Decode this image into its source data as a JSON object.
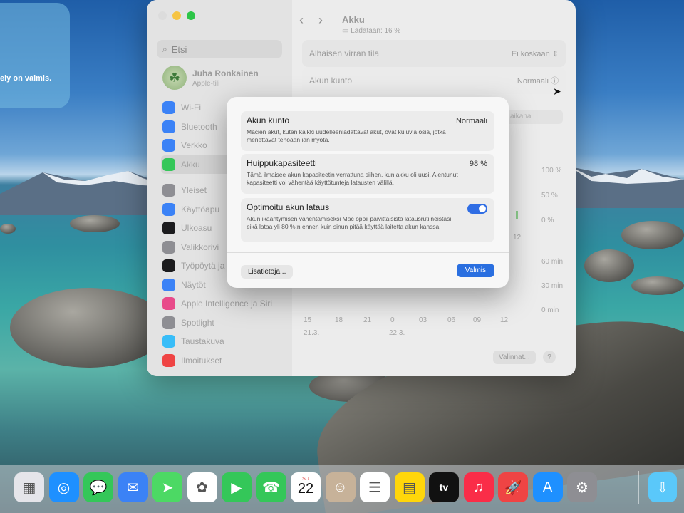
{
  "desktop": {
    "notification_text": "ely on valmis."
  },
  "window": {
    "header": {
      "title": "Akku",
      "subtitle": "Ladataan: 16 %",
      "back": "‹",
      "forward": "›"
    },
    "sidebar": {
      "search_placeholder": "Etsi",
      "user": {
        "name": "Juha Ronkainen",
        "subtitle": "Apple-tili"
      },
      "items": [
        {
          "label": "Wi-Fi",
          "icon": "wifi-icon",
          "color": "#3b82f6"
        },
        {
          "label": "Bluetooth",
          "icon": "bluetooth-icon",
          "color": "#3b82f6"
        },
        {
          "label": "Verkko",
          "icon": "globe-icon",
          "color": "#3b82f6"
        },
        {
          "label": "Akku",
          "icon": "battery-icon",
          "color": "#34c759",
          "active": true
        },
        {
          "label": "Yleiset",
          "icon": "gear-icon",
          "color": "#8e8e93",
          "gap": true
        },
        {
          "label": "Käyttöapu",
          "icon": "accessibility-icon",
          "color": "#3b82f6"
        },
        {
          "label": "Ulkoasu",
          "icon": "appearance-icon",
          "color": "#1c1c1e"
        },
        {
          "label": "Valikkorivi",
          "icon": "menubar-icon",
          "color": "#8e8e93"
        },
        {
          "label": "Työpöytä ja",
          "icon": "dock-icon",
          "color": "#1c1c1e"
        },
        {
          "label": "Näytöt",
          "icon": "display-icon",
          "color": "#3b82f6"
        },
        {
          "label": "Apple Intelligence ja Siri",
          "icon": "siri-icon",
          "color": "#e84b8a"
        },
        {
          "label": "Spotlight",
          "icon": "spotlight-icon",
          "color": "#8e8e93"
        },
        {
          "label": "Taustakuva",
          "icon": "wallpaper-icon",
          "color": "#38bdf8"
        },
        {
          "label": "Ilmoitukset",
          "icon": "notifications-icon",
          "color": "#ef4444"
        }
      ]
    },
    "rows": [
      {
        "label": "Alhaisen virran tila",
        "value": "Ei koskaan"
      },
      {
        "label": "Akun kunto",
        "value": "Normaali"
      }
    ],
    "hint_text": "aikana",
    "chart": {
      "y_top": [
        "100 %",
        "50 %",
        "0 %"
      ],
      "x_top_partial": "12",
      "y_bottom": [
        "60 min",
        "30 min",
        "0 min"
      ],
      "x_bottom": [
        "15",
        "18",
        "21",
        "0",
        "03",
        "06",
        "09",
        "12"
      ],
      "dates": [
        "21.3.",
        "22.3."
      ]
    },
    "footer": {
      "options_label": "Valinnat...",
      "help_label": "?"
    }
  },
  "dialog": {
    "sections": [
      {
        "title": "Akun kunto",
        "value": "Normaali",
        "description": "Macien akut, kuten kaikki uudelleenladattavat akut, ovat kuluvia osia, jotka menettävät tehoaan iän myötä."
      },
      {
        "title": "Huippukapasiteetti",
        "value": "98 %",
        "description": "Tämä ilmaisee akun kapasiteetin verrattuna siihen, kun akku oli uusi. Alentunut kapasiteetti voi vähentää käyttötunteja latausten välillä."
      },
      {
        "title": "Optimoitu akun lataus",
        "toggle_on": true,
        "description": "Akun ikääntymisen vähentämiseksi Mac oppii päivittäisistä latausrutiineistasi eikä lataa yli 80 %:n ennen kuin sinun pitää käyttää laitetta akun kanssa."
      }
    ],
    "buttons": {
      "more_info": "Lisätietoja...",
      "done": "Valmis"
    }
  },
  "dock": {
    "calendar": {
      "month": "SU",
      "day": "22"
    },
    "apple_tv_label": "tv",
    "apps": [
      {
        "name": "launchpad-icon",
        "color": "#e5e5ea"
      },
      {
        "name": "safari-icon",
        "color": "#1e90ff"
      },
      {
        "name": "messages-icon",
        "color": "#34c759"
      },
      {
        "name": "mail-icon",
        "color": "#3b82f6"
      },
      {
        "name": "maps-icon",
        "color": "#4cd964"
      },
      {
        "name": "photos-icon",
        "color": "#ffffff"
      },
      {
        "name": "facetime-icon",
        "color": "#34c759"
      },
      {
        "name": "phone-icon",
        "color": "#34c759"
      },
      {
        "name": "calendar-icon",
        "color": "#ffffff"
      },
      {
        "name": "contacts-icon",
        "color": "#c7b299"
      },
      {
        "name": "reminders-icon",
        "color": "#ffffff"
      },
      {
        "name": "notes-icon",
        "color": "#ffd60a"
      },
      {
        "name": "apple-tv-icon",
        "color": "#111111"
      },
      {
        "name": "music-icon",
        "color": "#fa2d48"
      },
      {
        "name": "rocketsim-icon",
        "color": "#ef4444"
      },
      {
        "name": "app-store-icon",
        "color": "#1e90ff"
      },
      {
        "name": "system-settings-icon",
        "color": "#8e8e93"
      },
      {
        "name": "downloads-folder-icon",
        "color": "#5ac8fa"
      }
    ]
  }
}
